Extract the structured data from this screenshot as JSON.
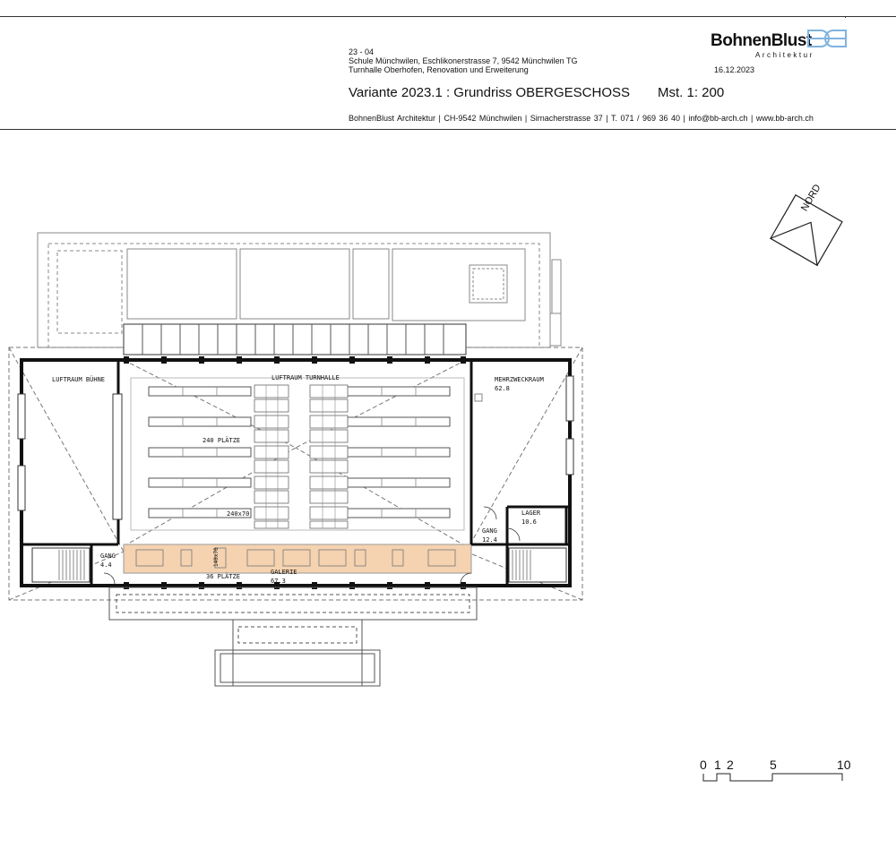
{
  "header": {
    "project_no": "23 - 04",
    "address": "Schule Münchwilen, Eschlikonerstrasse 7, 9542 Münchwilen TG",
    "project_name": "Turnhalle Oberhofen, Renovation und Erweiterung",
    "date": "16.12.2023",
    "title": "Variante 2023.1 : Grundriss OBERGESCHOSS",
    "scale": "Mst. 1: 200",
    "contact": "BohnenBlust Architektur   |   CH-9542 Münchwilen   |   Sirnacherstrasse 37   |   T. 071 / 969 36 40   |   info@bb-arch.ch   |   www.bb-arch.ch"
  },
  "logo": {
    "name": "BohnenBlust",
    "sub": "Architektur",
    "color": "#7fb3e0"
  },
  "north": {
    "label": "NORD"
  },
  "rooms": {
    "luftraum_buehne": "LUFTRAUM BÜHNE",
    "luftraum_turnhalle": "LUFTRAUM TURNHALLE",
    "plaetze_240": "240 PLÄTZE",
    "table_size": "240x70",
    "mehrzweckraum": "MEHRZWECKRAUM",
    "mehrzweckraum_area": "62.8",
    "lager": "LAGER",
    "lager_area": "10.6",
    "gang_right": "GANG",
    "gang_right_area": "12.4",
    "gang_left": "GANG",
    "gang_left_area": "4.4",
    "galerie": "GALERIE",
    "galerie_area": "67.3",
    "plaetze_36": "36 PLÄTZE",
    "galerie_table": "140x70"
  },
  "galerie_color": "#f5d2b0",
  "scale_bar": {
    "labels": [
      "0",
      "1",
      "2",
      "5",
      "10"
    ]
  }
}
